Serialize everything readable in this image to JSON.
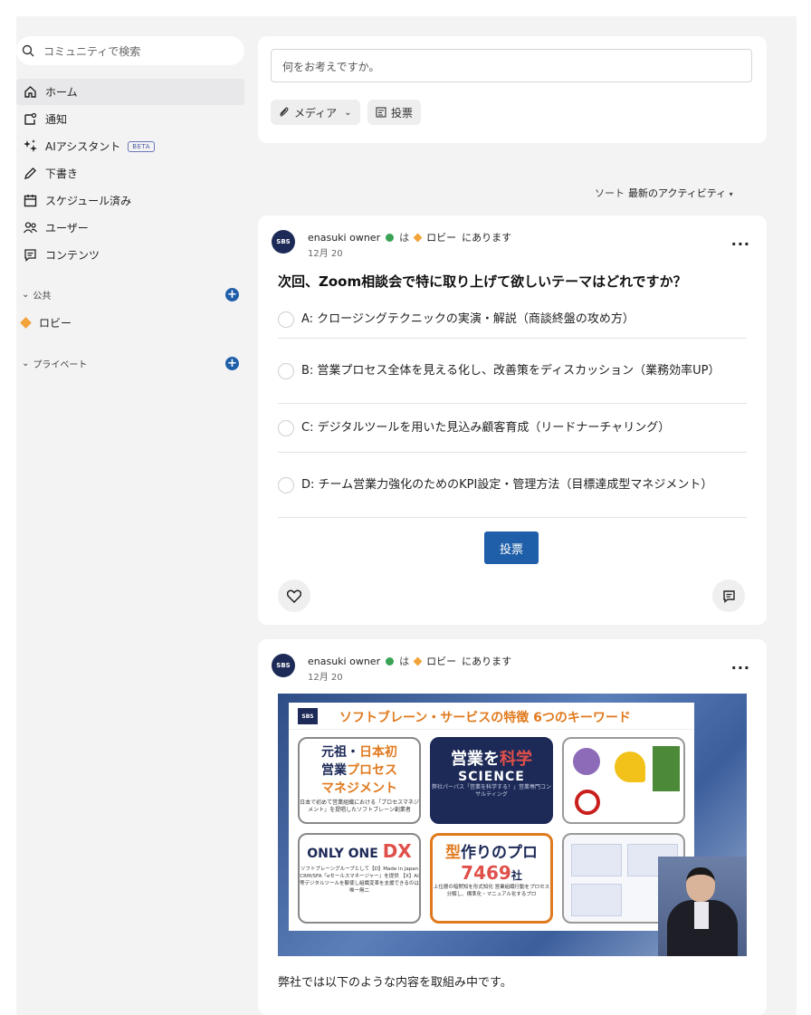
{
  "sidebar": {
    "search_placeholder": "コミュニティで検索",
    "items": [
      {
        "label": "ホーム",
        "icon": "home-icon",
        "active": true
      },
      {
        "label": "通知",
        "icon": "notification-icon"
      },
      {
        "label": "AIアシスタント",
        "icon": "sparkle-icon",
        "badge": "BETA"
      },
      {
        "label": "下書き",
        "icon": "pencil-icon"
      },
      {
        "label": "スケジュール済み",
        "icon": "calendar-icon"
      },
      {
        "label": "ユーザー",
        "icon": "users-icon"
      },
      {
        "label": "コンテンツ",
        "icon": "content-icon"
      }
    ],
    "public_section": "公共",
    "lobby": "ロビー",
    "private_section": "プライベート"
  },
  "composer": {
    "placeholder": "何をお考えですか。",
    "media_label": "メディア",
    "poll_label": "投票"
  },
  "sort": {
    "label": "ソート",
    "value": "最新のアクティビティ"
  },
  "posts": [
    {
      "author": "enasuki owner",
      "in_text": "は",
      "channel": "ロビー",
      "suffix": "にあります",
      "date": "12月 20",
      "title": "次回、Zoom相談会で特に取り上げて欲しいテーマはどれですか？",
      "options": [
        "A: クロージングテクニックの実演・解説（商談終盤の攻め方）",
        "B: 営業プロセス全体を見える化し、改善策をディスカッション（業務効率UP）",
        "C: デジタルツールを用いた見込み顧客育成（リードナーチャリング）",
        "D: チーム営業力強化のためのKPI設定・管理方法（目標達成型マネジメント）"
      ],
      "vote_label": "投票"
    },
    {
      "author": "enasuki owner",
      "in_text": "は",
      "channel": "ロビー",
      "suffix": "にあります",
      "date": "12月 20",
      "caption": "弊社では以下のような内容を取組み中です。",
      "slide": {
        "logo": "SBS",
        "title": "ソフトブレーン・サービスの特徴 6つのキーワード",
        "box1": {
          "line1a": "元祖・",
          "line1b": "日本初",
          "line2a": "営業",
          "line2b": "プロセス",
          "line3": "マネジメント",
          "small": "日本で初めて営業組織における「プロセスマネジメント」を提唱したソフトブレーン創業者"
        },
        "box2": {
          "line1a": "営業を",
          "line1b": "科学",
          "line2": "SCIENCE",
          "small": "弊社パーパス「営業を科学する！」営業専門コンサルティング"
        },
        "box4": {
          "line1": "ONLY ONE",
          "line1b": "DX",
          "small": "ソフトブレーングループとして【D】Made in Japan CRM/SFA『eセールスマネージャー』を提供 【X】AI等デジタルツールを駆使し組織変革を支援できるのは唯一無二"
        },
        "box5": {
          "line1a": "型",
          "line1b": "作りのプロ",
          "number": "7469",
          "unit": "社",
          "small": "上位層の暗黙知を形式知化 営業組織行動をプロセス分解し、標準化・マニュアル化するプロ"
        }
      }
    }
  ]
}
